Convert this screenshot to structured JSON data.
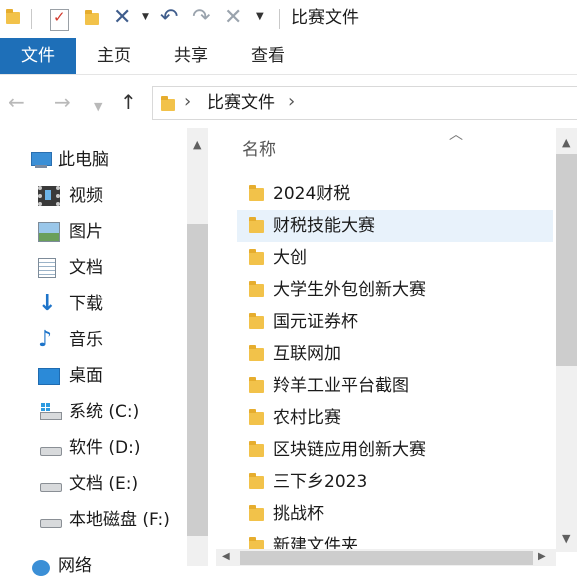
{
  "window": {
    "title": "比赛文件"
  },
  "ribbon": {
    "tabs": [
      "文件",
      "主页",
      "共享",
      "查看"
    ]
  },
  "address": {
    "path_label": "比赛文件"
  },
  "nav_pane": {
    "items": [
      {
        "label": "此电脑",
        "icon": "computer-icon"
      },
      {
        "label": "视频",
        "icon": "video-icon"
      },
      {
        "label": "图片",
        "icon": "picture-icon"
      },
      {
        "label": "文档",
        "icon": "document-icon"
      },
      {
        "label": "下载",
        "icon": "download-icon"
      },
      {
        "label": "音乐",
        "icon": "music-icon"
      },
      {
        "label": "桌面",
        "icon": "desktop-icon"
      },
      {
        "label": "系统 (C:)",
        "icon": "windows-drive-icon"
      },
      {
        "label": "软件 (D:)",
        "icon": "drive-icon"
      },
      {
        "label": "文档 (E:)",
        "icon": "drive-icon"
      },
      {
        "label": "本地磁盘 (F:)",
        "icon": "drive-icon"
      },
      {
        "label": "网络",
        "icon": "network-icon"
      }
    ]
  },
  "list": {
    "column_header": "名称",
    "items": [
      {
        "name": "2024财税",
        "selected": false
      },
      {
        "name": "财税技能大赛",
        "selected": true
      },
      {
        "name": "大创",
        "selected": false
      },
      {
        "name": "大学生外包创新大赛",
        "selected": false
      },
      {
        "name": "国元证券杯",
        "selected": false
      },
      {
        "name": "互联网加",
        "selected": false
      },
      {
        "name": "羚羊工业平台截图",
        "selected": false
      },
      {
        "name": "农村比赛",
        "selected": false
      },
      {
        "name": "区块链应用创新大赛",
        "selected": false
      },
      {
        "name": "三下乡2023",
        "selected": false
      },
      {
        "name": "挑战杯",
        "selected": false
      },
      {
        "name": "新建文件夹",
        "selected": false
      }
    ]
  },
  "colors": {
    "accent": "#1e6fb8",
    "folder": "#f2c24a",
    "selection": "#e8f2fb"
  }
}
